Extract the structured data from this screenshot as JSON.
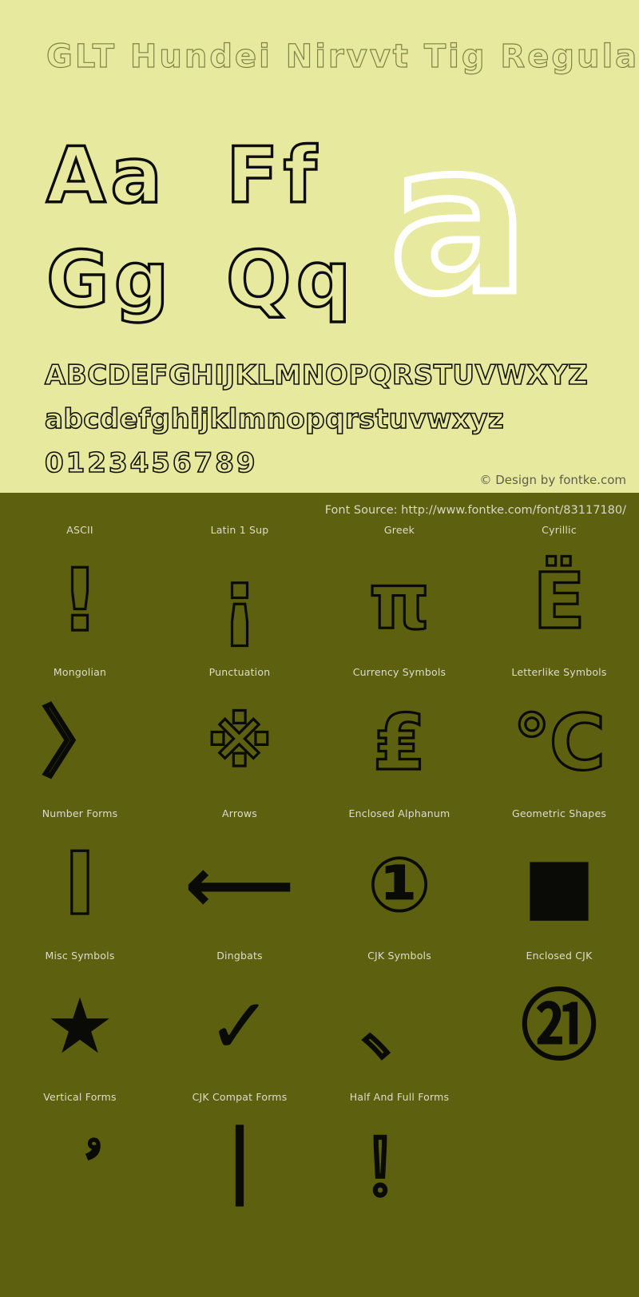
{
  "specimen": {
    "title": "GLT Hundei Nirvvt Tig Regular",
    "pairs": [
      {
        "name": "pair-aa",
        "text": "Aa"
      },
      {
        "name": "pair-ff",
        "text": "Ff"
      },
      {
        "name": "pair-gg",
        "text": "Gg"
      },
      {
        "name": "pair-qq",
        "text": "Qq"
      }
    ],
    "feature_letter": "a",
    "alphabet_uppercase": "ABCDEFGHIJKLMNOPQRSTUVWXYZ",
    "alphabet_lowercase": "abcdefghijklmnopqrstuvwxyz",
    "digits": "0123456789",
    "credit": "© Design by fontke.com",
    "colors": {
      "specimen_background": "#e7ea9e",
      "coverage_background": "#5c600f",
      "glyph_stroke": "#0a0a06",
      "feature_letter_stroke": "#ffffff",
      "title_stroke": "#7e8347",
      "credit_text": "#5d5f4e",
      "label_text": "#ddddcb"
    }
  },
  "coverage": {
    "source_label": "Font Source: http://www.fontke.com/font/83117180/",
    "rows": [
      [
        {
          "label": "ASCII",
          "glyph": "!",
          "size": "g-sz-xl"
        },
        {
          "label": "Latin 1 Sup",
          "glyph": "¡",
          "size": "g-sz-xl"
        },
        {
          "label": "Greek",
          "glyph": "π",
          "size": "g-sz-lg"
        },
        {
          "label": "Cyrillic",
          "glyph": "Ё",
          "size": "g-sz-lg"
        }
      ],
      [
        {
          "label": "Mongolian",
          "glyph": "〉",
          "size": "g-sz-lg"
        },
        {
          "label": "Punctuation",
          "glyph": "※",
          "size": "g-sz-md"
        },
        {
          "label": "Currency Symbols",
          "glyph": "₤",
          "size": "g-sz-lg"
        },
        {
          "label": "Letterlike Symbols",
          "glyph": "℃",
          "size": "g-sz-lg"
        }
      ],
      [
        {
          "label": "Number Forms",
          "glyph": "Ⅰ",
          "size": "g-sz-xl"
        },
        {
          "label": "Arrows",
          "glyph": "⟵",
          "size": "g-sz-lg"
        },
        {
          "label": "Enclosed Alphanum",
          "glyph": "①",
          "size": "g-sz-lg"
        },
        {
          "label": "Geometric Shapes",
          "glyph": "■",
          "size": "g-sz-lg"
        }
      ],
      [
        {
          "label": "Misc Symbols",
          "glyph": "★",
          "size": "g-sz-lg"
        },
        {
          "label": "Dingbats",
          "glyph": "✓",
          "size": "g-sz-lg"
        },
        {
          "label": "CJK Symbols",
          "glyph": "、",
          "size": "g-sz-lg"
        },
        {
          "label": "Enclosed CJK",
          "glyph": "㉑",
          "size": "g-sz-lg"
        }
      ],
      [
        {
          "label": "Vertical Forms",
          "glyph": "︐",
          "size": "g-sz-sm"
        },
        {
          "label": "CJK Compat Forms",
          "glyph": "｜",
          "size": "g-sz-lg"
        },
        {
          "label": "Half And Full Forms",
          "glyph": "！",
          "size": "g-sz-lg"
        },
        {
          "label": "",
          "glyph": "",
          "size": "g-sz-lg"
        }
      ]
    ]
  }
}
